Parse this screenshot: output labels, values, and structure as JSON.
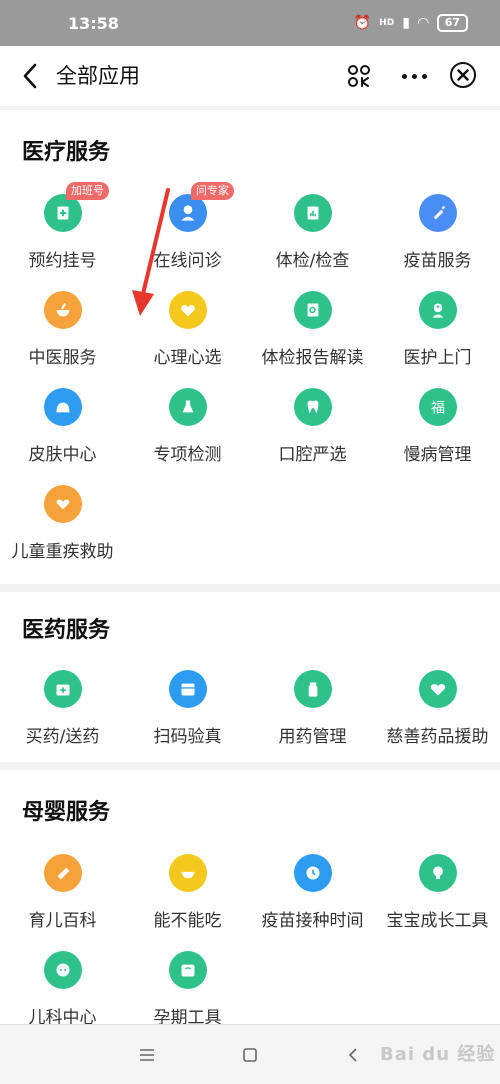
{
  "status_bar": {
    "time": "13:58",
    "network": "HD",
    "battery": "67"
  },
  "nav": {
    "title": "全部应用"
  },
  "sections": [
    {
      "title": "医疗服务",
      "items": [
        {
          "label": "预约挂号",
          "icon": "hospital-icon",
          "color": "#2ec28a",
          "badge": "加班号"
        },
        {
          "label": "在线问诊",
          "icon": "doctor-icon",
          "color": "#3a8ef0",
          "badge": "问专家"
        },
        {
          "label": "体检/检查",
          "icon": "report-chart-icon",
          "color": "#2ec28a"
        },
        {
          "label": "疫苗服务",
          "icon": "syringe-icon",
          "color": "#4a8ef5"
        },
        {
          "label": "中医服务",
          "icon": "mortar-icon",
          "color": "#f5a23a"
        },
        {
          "label": "心理心选",
          "icon": "heart-icon",
          "color": "#f5c81e"
        },
        {
          "label": "体检报告解读",
          "icon": "report-search-icon",
          "color": "#2ec28a"
        },
        {
          "label": "医护上门",
          "icon": "nurse-icon",
          "color": "#2ec28a"
        },
        {
          "label": "皮肤中心",
          "icon": "skin-icon",
          "color": "#2d9cf0"
        },
        {
          "label": "专项检测",
          "icon": "flask-icon",
          "color": "#2ec28a"
        },
        {
          "label": "口腔严选",
          "icon": "tooth-icon",
          "color": "#2ec28a"
        },
        {
          "label": "慢病管理",
          "icon": "fortune-icon",
          "color": "#2ec28a"
        },
        {
          "label": "儿童重疾救助",
          "icon": "heart-hand-icon",
          "color": "#f5a23a"
        }
      ]
    },
    {
      "title": "医药服务",
      "items": [
        {
          "label": "买药/送药",
          "icon": "medicine-box-icon",
          "color": "#2ec28a"
        },
        {
          "label": "扫码验真",
          "icon": "scan-box-icon",
          "color": "#2d9cf0"
        },
        {
          "label": "用药管理",
          "icon": "pill-bottle-icon",
          "color": "#2ec28a"
        },
        {
          "label": "慈善药品援助",
          "icon": "charity-heart-icon",
          "color": "#2ec28a"
        }
      ]
    },
    {
      "title": "母婴服务",
      "items": [
        {
          "label": "育儿百科",
          "icon": "book-icon",
          "color": "#f5a23a"
        },
        {
          "label": "能不能吃",
          "icon": "bowl-icon",
          "color": "#f5c81e"
        },
        {
          "label": "疫苗接种时间",
          "icon": "clock-icon",
          "color": "#2d9cf0"
        },
        {
          "label": "宝宝成长工具",
          "icon": "lightbulb-icon",
          "color": "#2ec28a"
        },
        {
          "label": "儿科中心",
          "icon": "baby-face-icon",
          "color": "#2ec28a"
        },
        {
          "label": "孕期工具",
          "icon": "scale-icon",
          "color": "#2ec28a"
        }
      ]
    }
  ],
  "watermark": "Bai du 经验"
}
